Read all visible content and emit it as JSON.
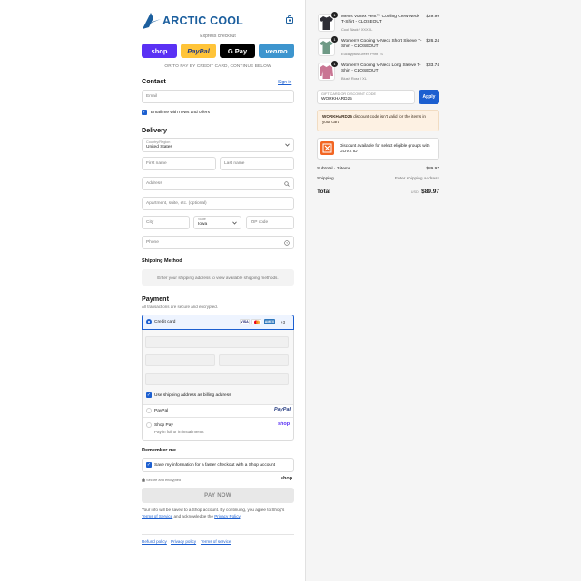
{
  "brand": {
    "name": "ARCTIC COOL",
    "color": "#1c5f9e"
  },
  "express": {
    "title": "Express checkout",
    "buttons": [
      {
        "id": "shop",
        "label": "shop",
        "bg": "#5a31f4",
        "fg": "#ffffff"
      },
      {
        "id": "paypal",
        "label": "PayPal",
        "bg": "#ffc439",
        "fg": "#253b80"
      },
      {
        "id": "gpay",
        "label": "G Pay",
        "bg": "#000000",
        "fg": "#ffffff"
      },
      {
        "id": "venmo",
        "label": "venmo",
        "bg": "#3d95ce",
        "fg": "#ffffff"
      }
    ],
    "divider": "OR TO PAY BY CREDIT CARD, CONTINUE BELOW"
  },
  "contact": {
    "title": "Contact",
    "signin": "Sign in",
    "email_placeholder": "Email",
    "news_label": "Email me with news and offers"
  },
  "delivery": {
    "title": "Delivery",
    "country_label": "Country/Region",
    "country_value": "United States",
    "first_placeholder": "First name",
    "last_placeholder": "Last name",
    "address_placeholder": "Address",
    "apt_placeholder": "Apartment, suite, etc. (optional)",
    "city_placeholder": "City",
    "state_label": "State",
    "state_value": "Iowa",
    "zip_placeholder": "ZIP code",
    "phone_placeholder": "Phone"
  },
  "shipping_method": {
    "title": "Shipping Method",
    "message": "Enter your shipping address to view available shipping methods."
  },
  "payment": {
    "title": "Payment",
    "subtitle": "All transactions are secure and encrypted.",
    "credit_card_label": "Credit card",
    "card_brands": [
      "VISA",
      "MC",
      "AMEX"
    ],
    "more_cards": "+3",
    "billing_label": "Use shipping address as billing address",
    "paypal_label": "PayPal",
    "paypal_logo": "PayPal",
    "shoppay_label": "Shop Pay",
    "shoppay_sub": "Pay in full or in installments",
    "shoppay_logo": "shop"
  },
  "remember": {
    "title": "Remember me",
    "save_label": "Save my information for a faster checkout with a Shop account",
    "secure": "Secure and encrypted",
    "shop_logo": "shop"
  },
  "pay_now": "PAY NOW",
  "legal": {
    "text_1": "Your info will be saved to a Shop account. By continuing, you agree to Shop's",
    "terms": "Terms of Service",
    "text_2": " and acknowledge the ",
    "privacy": "Privacy Policy",
    "text_3": "."
  },
  "footer_links": [
    "Refund policy",
    "Privacy policy",
    "Terms of service"
  ],
  "cart": {
    "items": [
      {
        "qty": "1",
        "title": "Men's Vortex Vent™ Cooling Crew Neck T-Shirt - CLOSEOUT",
        "variant": "Cool Black / XXXXL",
        "price": "$29.99",
        "color": "#2c2c34"
      },
      {
        "qty": "1",
        "title": "Women's Cooling V-Neck Short Sleeve T-Shirt - CLOSEOUT",
        "variant": "Eucalyptus Green Print / S",
        "price": "$26.24",
        "color": "#6f9a86"
      },
      {
        "qty": "1",
        "title": "Women's Cooling V-Neck Long Sleeve T-Shirt - CLOSEOUT",
        "variant": "Blush Rose / XL",
        "price": "$33.74",
        "color": "#c97593"
      }
    ],
    "discount_label": "GIFT CARD OR DISCOUNT CODE",
    "discount_value": "WORKHARD25",
    "apply": "Apply",
    "error_code": "WORKHARD25",
    "error_text": " discount code isn't valid for the items in your cart",
    "govx_text": "Discount available for select eligible groups with GOVX ID",
    "subtotal_label": "Subtotal · 3 items",
    "subtotal_value": "$89.97",
    "shipping_label": "Shipping",
    "shipping_value": "Enter shipping address",
    "total_label": "Total",
    "total_currency": "USD",
    "total_value": "$89.97"
  }
}
